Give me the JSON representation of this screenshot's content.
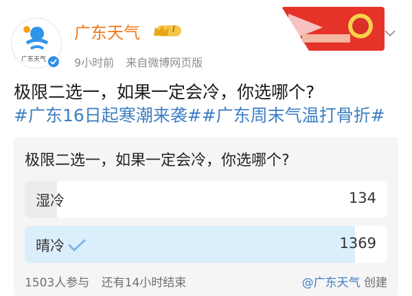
{
  "author": {
    "avatar_caption": "广东天气",
    "name": "广东天气",
    "vip_level": "I",
    "time": "9小时前",
    "source": "来自微博网页版"
  },
  "post": {
    "text": "极限二选一，如果一定会冷，你选哪个?",
    "hashtags": "#广东16日起寒潮来袭##广东周末气温打骨折#"
  },
  "poll": {
    "question": "极限二选一，如果一定会冷，你选哪个?",
    "options": [
      {
        "label": "湿冷",
        "count": "134",
        "share": 0.089,
        "selected": false
      },
      {
        "label": "晴冷",
        "count": "1369",
        "share": 0.911,
        "selected": true
      }
    ],
    "participants": "1503人参与",
    "remaining": "还有14小时结束",
    "creator_handle": "@广东天气",
    "creator_suffix": "创建"
  },
  "colors": {
    "name": "#ee7a1c",
    "link": "#3d7fc4",
    "selected_fill": "#dbeefc",
    "verified": "#2f8fe6"
  },
  "icons": [
    "avatar-logo",
    "vip-crown-icon",
    "verified-icon",
    "banner-image",
    "chevron-down-icon",
    "checkmark-icon"
  ]
}
